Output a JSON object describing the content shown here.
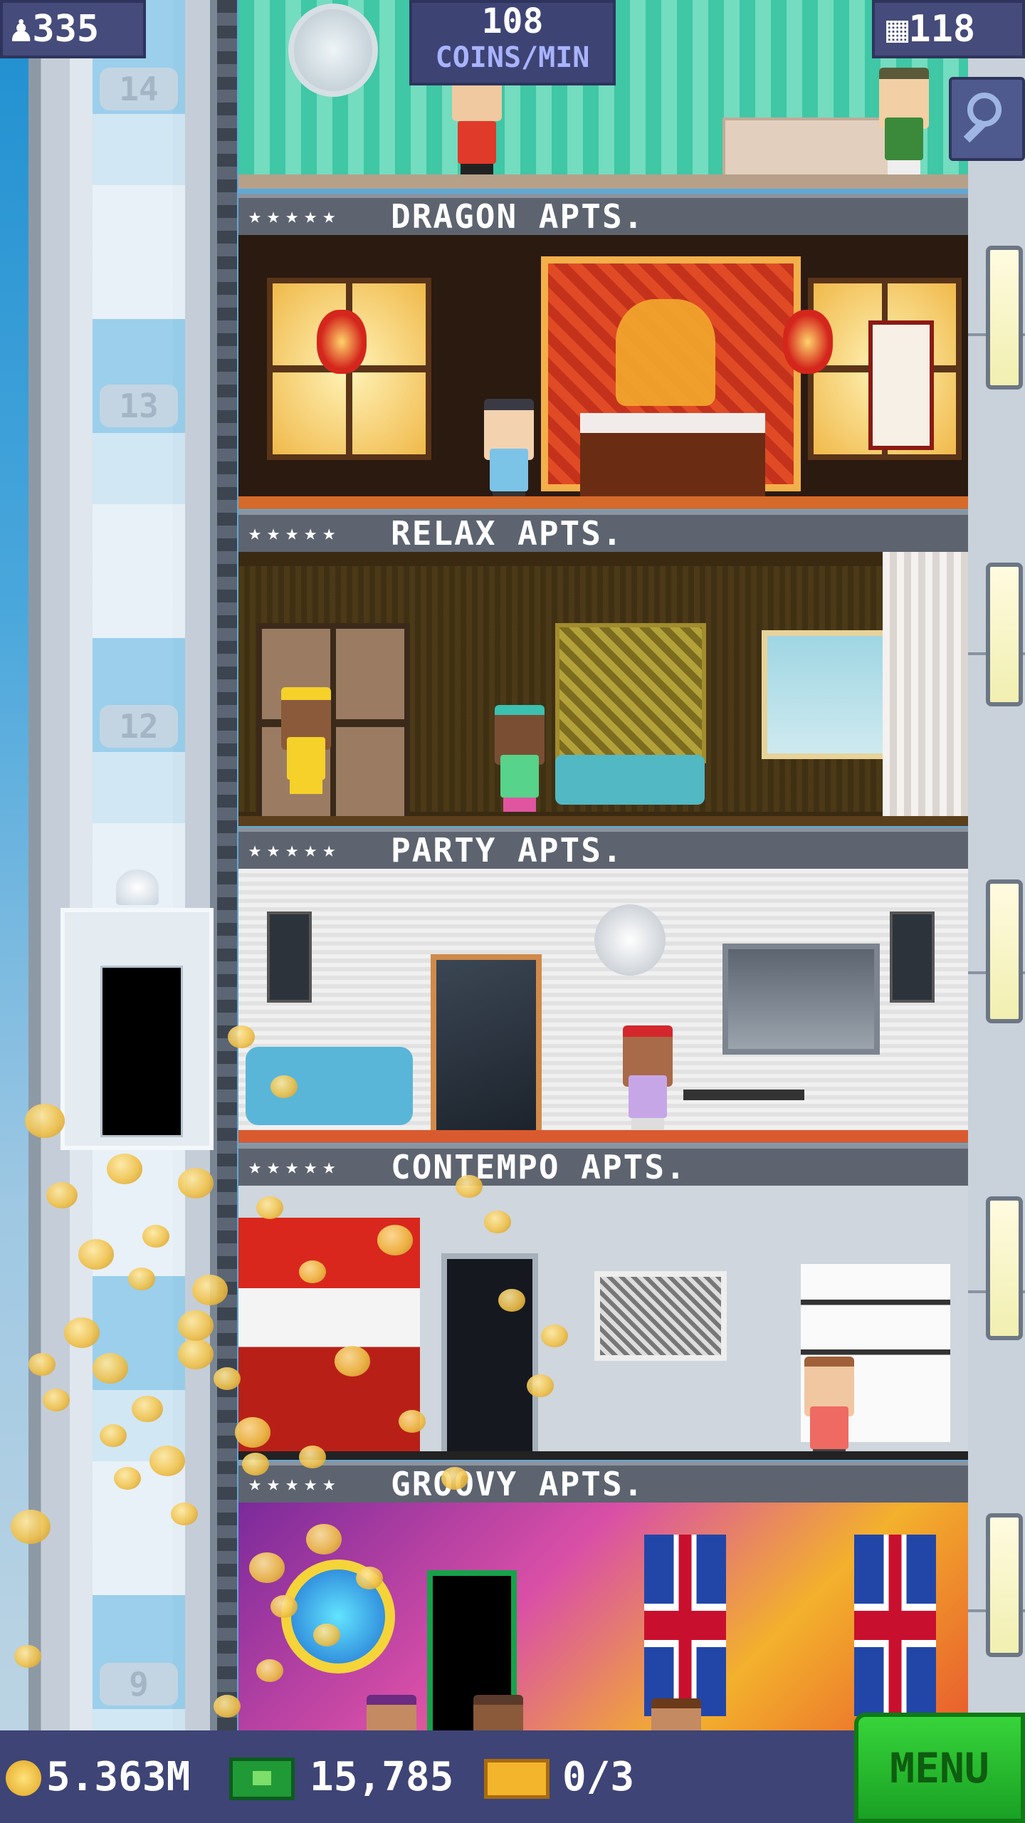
{
  "hud": {
    "population": "335",
    "population_icon": "person-icon",
    "coin_rate": "108",
    "coin_rate_unit": "COINS/MIN",
    "floor_count": "118",
    "floor_icon": "building-icon",
    "zoom_icon": "magnifier-icon"
  },
  "elevator": {
    "floor_labels": [
      "14",
      "13",
      "12",
      "9"
    ]
  },
  "floors": [
    {
      "name": "DRAGON APTS.",
      "stars": "★★★★★"
    },
    {
      "name": "RELAX APTS.",
      "stars": "★★★★★"
    },
    {
      "name": "PARTY APTS.",
      "stars": "★★★★★"
    },
    {
      "name": "CONTEMPO APTS.",
      "stars": "★★★★★"
    },
    {
      "name": "GROOVY APTS.",
      "stars": "★★★★★"
    }
  ],
  "bottom_bar": {
    "coins": "5.363M",
    "bux": "15,785",
    "tickets": "0/3",
    "menu_label": "MENU"
  },
  "colors": {
    "hud_bg": "#454b7a",
    "menu_green": "#1aa124",
    "coin_gold": "#f1c24b"
  }
}
